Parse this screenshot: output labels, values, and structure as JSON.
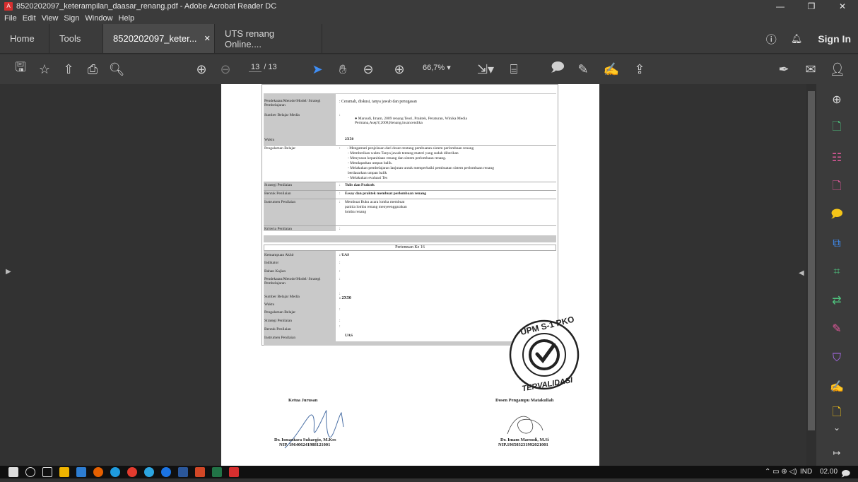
{
  "window": {
    "title": "8520202097_keterampilan_daasar_renang.pdf - Adobe Acrobat Reader DC"
  },
  "menu": [
    "File",
    "Edit",
    "View",
    "Sign",
    "Window",
    "Help"
  ],
  "tabs": {
    "home": "Home",
    "tools": "Tools",
    "doc1": "8520202097_keter...",
    "doc2": "UTS renang Online...."
  },
  "account": {
    "signin": "Sign In"
  },
  "toolbar": {
    "page_current": "13",
    "page_total": "/ 13",
    "zoom": "66,7%"
  },
  "document": {
    "rows_top": [
      {
        "label": "Pendekatan/Metode/Model/ Strategi Pembelajaran",
        "value": ": Ceramah, diskusi, tanya jawab dan penugasan"
      },
      {
        "label": "Sumber Belajar Media",
        "value": "Marsudi, Imam, 2009 renang Teori, Praktek, Peraturan, Winika Media Permana,AsepY,2008,Renang,insancendika"
      },
      {
        "label": "Waktu",
        "value": "2X50"
      },
      {
        "label": "Pengalaman Belajar",
        "value": "- Mengamati penjelasan dari dosen tentang pembuatan sistem perlombaan renang"
      }
    ],
    "pengalaman": [
      "- Memberikan waktu Tanya jawab tentang materi yang sudah diberikan",
      "- Menyusun kepanitiaan renang dan sistem perlombaan renang.",
      "- Mendapatkan umpan balik.",
      "- Melakukan pembelajaran lanjutan untuk memperbaiki pembuatan sistem perlombaan renang",
      "berdasarkan umpan balik",
      "- Melakukan evaluasi Tes"
    ],
    "rows_mid": [
      {
        "label": "Strategi Penilaian",
        "value": "Tulis dan Praktek"
      },
      {
        "label": "Bentuk Penilaian",
        "value": "Essay dan praktek membuat perlombaan renang"
      },
      {
        "label": "Instrumen Penilaian",
        "value": "Membuat Buku acara lomba membuat"
      },
      {
        "label": "Kriteria Penilaian",
        "value": ""
      }
    ],
    "instrumen_extra": [
      "panitia lomba renang menyeenggarakan",
      "lomba renang"
    ],
    "meeting_title": "Pertemuan Ke 16",
    "rows_bottom": [
      {
        "label": "Kemampuan Akhir",
        "value": ": UAS"
      },
      {
        "label": "Indikator",
        "value": ":"
      },
      {
        "label": "Bahan Kajian",
        "value": ":"
      },
      {
        "label": "Pendekatan/Metode/Model/ Strategi Pembelajaran",
        "value": ":"
      },
      {
        "label": "Sumber Belajar Media",
        "value": ":"
      },
      {
        "label": "Waktu",
        "value": ": 2X50"
      },
      {
        "label": "Pengalaman Belajar",
        "value": ":"
      },
      {
        "label": "Strategi Penilaian",
        "value": ":"
      },
      {
        "label": "Bentuk Penilaian",
        "value": ":"
      },
      {
        "label": "Instrumen Penilaian",
        "value": "UAS"
      }
    ],
    "sign_left_title": "Ketua Jurusan",
    "sign_left_name": "Dr. Ismantara Suhargio, M.Kes",
    "sign_left_nip": "NIP. 196406241988121001",
    "sign_right_title": "Dosen Pengampu Matakuliah",
    "sign_right_name": "Dr. Imam Marsudi, M.Si",
    "sign_right_nip": "NIP.196503231992021001",
    "stamp_top": "UPM S-1 PKO",
    "stamp_bottom": "TERVALIDASI"
  },
  "taskbar": {
    "lang": "IND",
    "time": "02.00"
  },
  "colors": {
    "titlebar": "#3b3b3b",
    "accent_pink": "#e0589b",
    "accent_green": "#4ec27d",
    "accent_yellow": "#f5c518",
    "accent_blue": "#3f8ef5",
    "accent_purple": "#b06ef5",
    "accent_red": "#d62f2f"
  }
}
